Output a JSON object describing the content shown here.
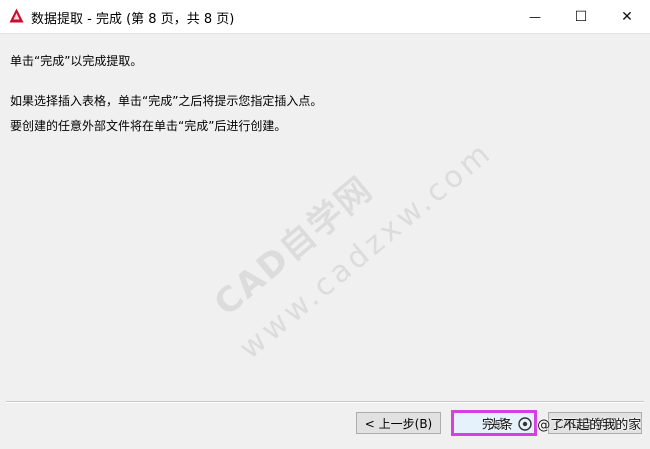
{
  "window": {
    "title": "数据提取 - 完成 (第 8 页，共 8 页)",
    "controls": {
      "minimize": "—",
      "maximize": "☐",
      "close": "✕"
    }
  },
  "content": {
    "line1": "单击“完成”以完成提取。",
    "line2": "如果选择插入表格，单击“完成”之后将提示您指定插入点。",
    "line3": "要创建的任意外部文件将在单击“完成”后进行创建。"
  },
  "watermark": {
    "line1": "CAD自学网",
    "line2": "www.cadzxw.com"
  },
  "footer": {
    "back_label": "< 上一步(B)",
    "finish_label": "完成",
    "cancel_label": "CAD自学网"
  },
  "attribution": {
    "prefix": "头条",
    "handle": "@了不起的我的家"
  },
  "colors": {
    "highlight": "#d63fe0",
    "app_icon": "#c8102e"
  },
  "icons": {
    "app": "autocad-logo-icon",
    "attribution": "toutiao-logo-icon"
  }
}
